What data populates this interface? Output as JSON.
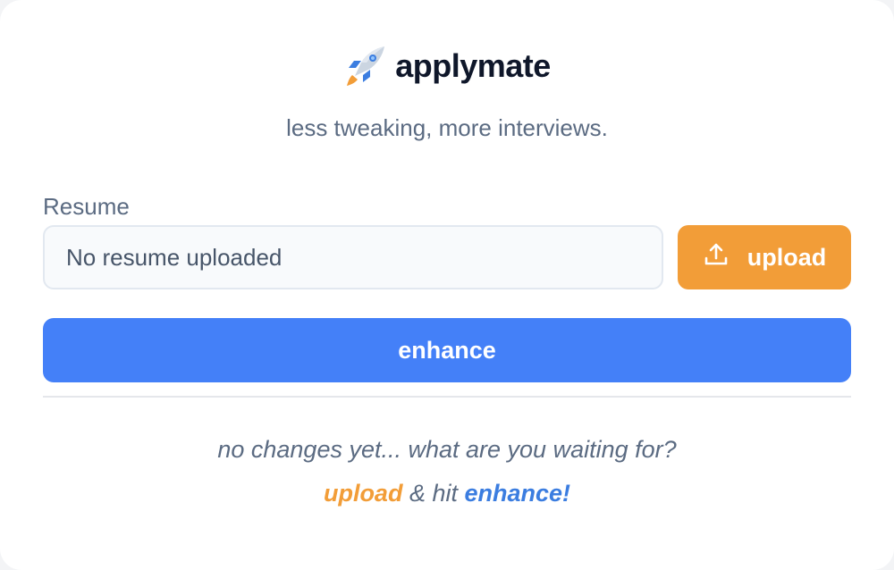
{
  "brand": {
    "name": "applymate",
    "icon": "rocket-icon",
    "tagline": "less tweaking, more interviews."
  },
  "resume": {
    "label": "Resume",
    "value": "No resume uploaded"
  },
  "upload_button": {
    "label": "upload",
    "icon": "upload-icon"
  },
  "enhance_button": {
    "label": "enhance"
  },
  "empty_state": {
    "message": "no changes yet... what are you waiting for?",
    "cta_upload": "upload",
    "cta_middle": " & hit ",
    "cta_enhance": "enhance!"
  },
  "colors": {
    "upload_orange": "#f29d38",
    "enhance_blue": "#4480f8",
    "text_muted": "#5b6b82",
    "text_dark": "#0f172a"
  }
}
